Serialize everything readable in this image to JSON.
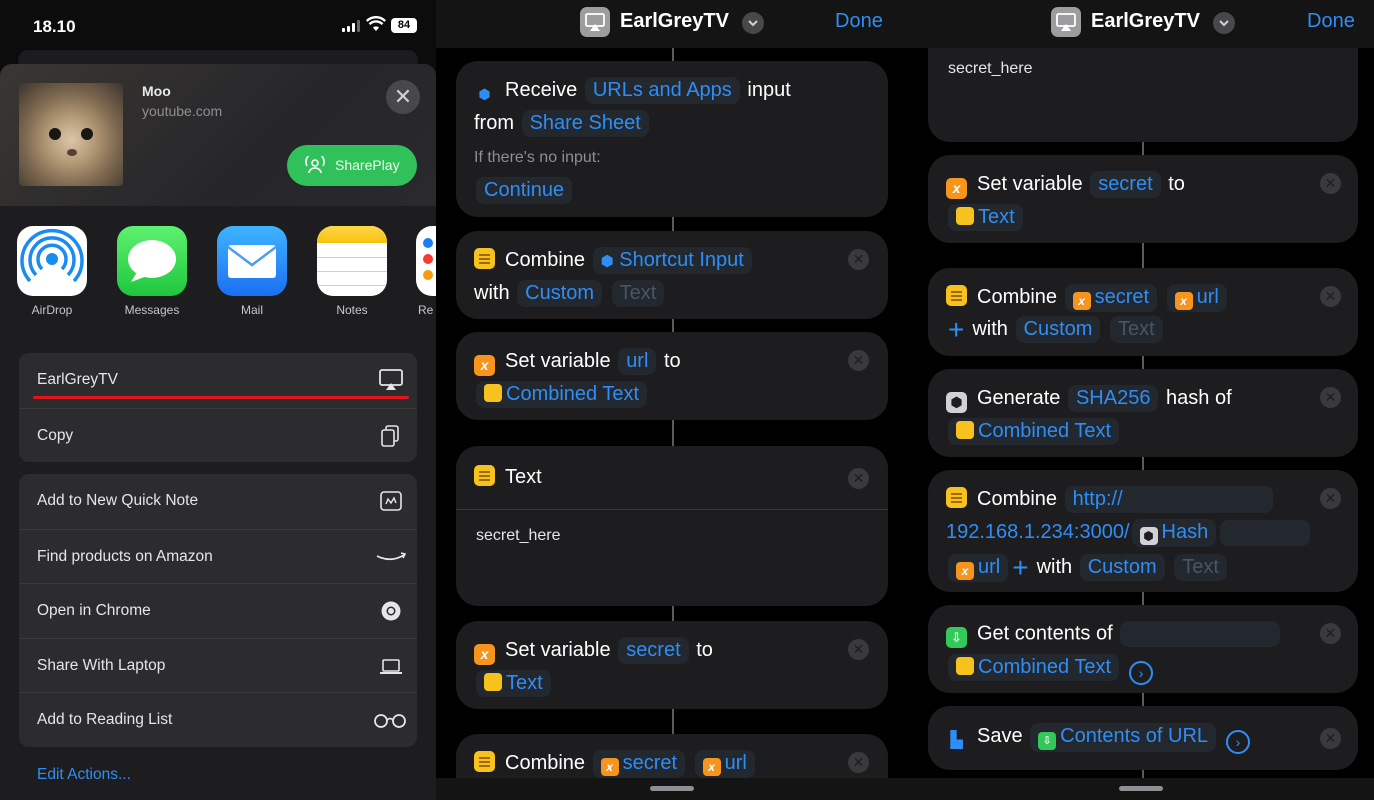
{
  "status_bar": {
    "time": "18.10",
    "battery": "84"
  },
  "share_header": {
    "title": "Moo",
    "subtitle": "youtube.com",
    "shareplay_label": "SharePlay"
  },
  "apps": [
    {
      "label": "AirDrop",
      "icon": "airdrop-icon"
    },
    {
      "label": "Messages",
      "icon": "messages-icon"
    },
    {
      "label": "Mail",
      "icon": "mail-icon"
    },
    {
      "label": "Notes",
      "icon": "notes-icon"
    },
    {
      "label": "Re",
      "icon": "reminders-icon"
    }
  ],
  "action_group_1": [
    {
      "label": "EarlGreyTV",
      "icon": "airplay-icon"
    },
    {
      "label": "Copy",
      "icon": "copy-icon"
    }
  ],
  "action_group_2": [
    {
      "label": "Add to New Quick Note",
      "icon": "quick-note-icon"
    },
    {
      "label": "Find products on Amazon",
      "icon": "amazon-icon"
    },
    {
      "label": "Open in Chrome",
      "icon": "chrome-icon"
    },
    {
      "label": "Share With Laptop",
      "icon": "laptop-icon"
    },
    {
      "label": "Add to Reading List",
      "icon": "glasses-icon"
    }
  ],
  "edit_actions": "Edit Actions...",
  "shortcut": {
    "name": "EarlGreyTV",
    "done": "Done"
  },
  "editor1": {
    "receive": {
      "verb": "Receive",
      "type": "URLs and Apps",
      "input": "input",
      "from": "from",
      "source": "Share Sheet",
      "no_input": "If there's no input:",
      "fallback": "Continue"
    },
    "combine1": {
      "verb": "Combine",
      "input": "Shortcut Input",
      "with": "with",
      "mode": "Custom",
      "placeholder": "Text"
    },
    "setvar1": {
      "verb": "Set variable",
      "name": "url",
      "to": "to",
      "value": "Combined Text"
    },
    "text": {
      "title": "Text",
      "body": "secret_here"
    },
    "setvar2": {
      "verb": "Set variable",
      "name": "secret",
      "to": "to",
      "value": "Text"
    },
    "combine2": {
      "verb": "Combine",
      "var1": "secret",
      "var2": "url"
    }
  },
  "editor2": {
    "text_body": "secret_here",
    "setvar": {
      "verb": "Set variable",
      "name": "secret",
      "to": "to",
      "value": "Text"
    },
    "combine1": {
      "verb": "Combine",
      "var1": "secret",
      "var2": "url",
      "with": "with",
      "mode": "Custom",
      "placeholder": "Text"
    },
    "hash": {
      "verb": "Generate",
      "algo": "SHA256",
      "hashof": "hash of",
      "value": "Combined Text"
    },
    "combine2": {
      "verb": "Combine",
      "url_line1": "http://",
      "url_line2": "192.168.1.234:3000/",
      "hash_var": "Hash",
      "url_var": "url",
      "with": "with",
      "mode": "Custom",
      "placeholder": "Text"
    },
    "getcontents": {
      "verb": "Get contents of",
      "value": "Combined Text"
    },
    "save": {
      "verb": "Save",
      "value": "Contents of URL"
    }
  },
  "colors": {
    "accent": "#2f8ef5",
    "shareplay": "#30c15a",
    "underline": "#e0141a",
    "text_action": "#f7c21e",
    "variable_action": "#f7941d"
  }
}
